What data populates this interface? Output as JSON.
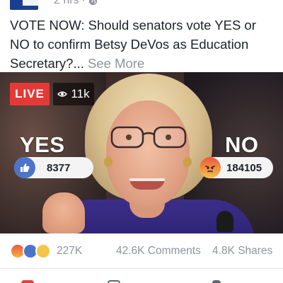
{
  "header": {
    "timestamp": "2 hrs",
    "separator": "·",
    "privacy_icon": "globe-icon"
  },
  "post": {
    "text": "VOTE NOW: Should senators vote YES or NO to confirm Betsy DeVos as Education Secretary?...",
    "see_more": "See More"
  },
  "video": {
    "live_label": "LIVE",
    "viewers": "11k",
    "yes_label": "YES",
    "yes_count": "8377",
    "no_label": "NO",
    "no_count": "184105"
  },
  "stats": {
    "reactions": "227K",
    "comments": "42.6K Comments",
    "shares": "4.8K Shares",
    "reaction_icons": [
      "angry-icon",
      "like-icon",
      "sad-icon"
    ]
  },
  "colors": {
    "live_red": "#e43a37",
    "like_blue": "#4c74c9",
    "meta_gray": "#90949c"
  }
}
